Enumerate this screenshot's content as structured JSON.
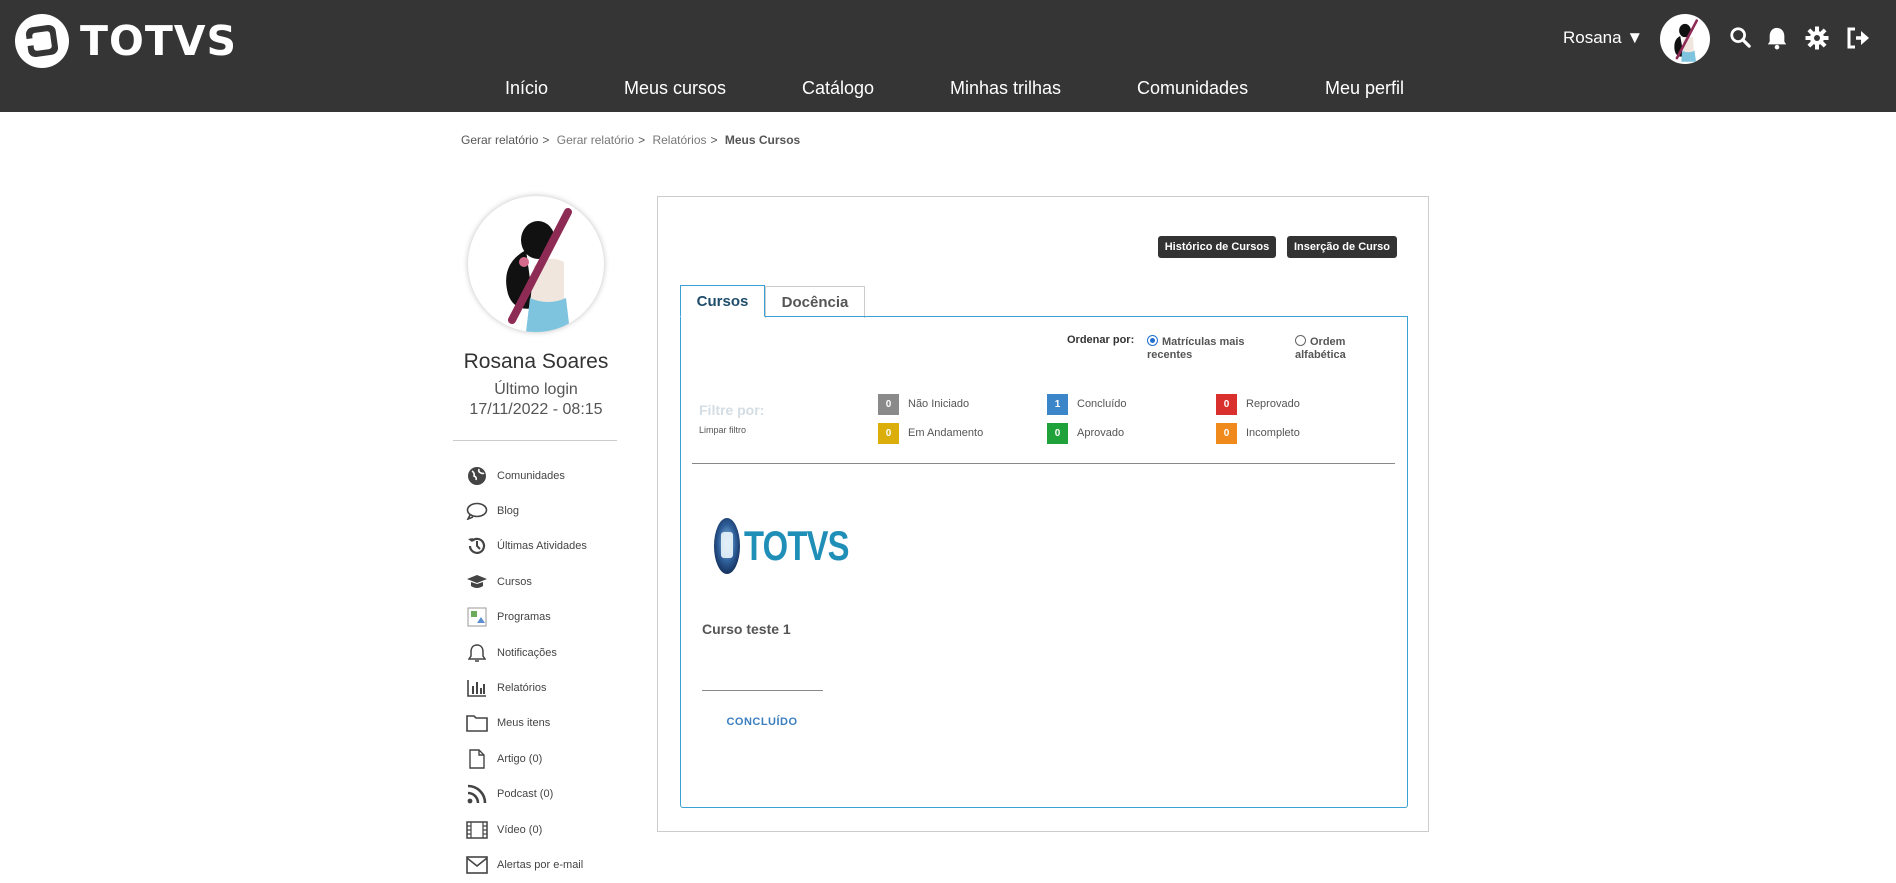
{
  "header": {
    "brand": "TOTVS",
    "nav": [
      "Início",
      "Meus cursos",
      "Catálogo",
      "Minhas trilhas",
      "Comunidades",
      "Meu perfil"
    ],
    "user_label": "Rosana ▼"
  },
  "breadcrumb": [
    "Gerar relatório",
    "Gerar relatório",
    "Relatórios",
    "Meus Cursos"
  ],
  "profile": {
    "name": "Rosana Soares",
    "last_login_label": "Último login",
    "last_login_value": "17/11/2022 - 08:15"
  },
  "menu": [
    {
      "label": "Comunidades",
      "icon": "globe-icon"
    },
    {
      "label": "Blog",
      "icon": "speech-bubble-icon"
    },
    {
      "label": "Últimas Atividades",
      "icon": "history-icon"
    },
    {
      "label": "Cursos",
      "icon": "graduation-cap-icon"
    },
    {
      "label": "Programas",
      "icon": "broken-image-icon"
    },
    {
      "label": "Notificações",
      "icon": "bell-icon"
    },
    {
      "label": "Relatórios",
      "icon": "bar-chart-icon"
    },
    {
      "label": "Meus itens",
      "icon": "folder-icon"
    },
    {
      "label": "Artigo (0)",
      "icon": "document-icon"
    },
    {
      "label": "Podcast (0)",
      "icon": "rss-icon"
    },
    {
      "label": "Vídeo (0)",
      "icon": "film-icon"
    },
    {
      "label": "Alertas por e-mail",
      "icon": "envelope-icon"
    }
  ],
  "buttons": {
    "history": "Histórico de Cursos",
    "insert": "Inserção de Curso"
  },
  "tabs": [
    "Cursos",
    "Docência"
  ],
  "order": {
    "label": "Ordenar por:",
    "options": [
      "Matrículas mais recentes",
      "Ordem alfabética"
    ],
    "selected": "Matrículas mais recentes"
  },
  "filter": {
    "title": "Filtre por:",
    "clear": "Limpar filtro",
    "items": [
      {
        "count": "0",
        "label": "Não Iniciado",
        "color": "#8a8a8a"
      },
      {
        "count": "1",
        "label": "Concluído",
        "color": "#3b86c8"
      },
      {
        "count": "0",
        "label": "Reprovado",
        "color": "#d9302e"
      },
      {
        "count": "0",
        "label": "Em Andamento",
        "color": "#dcae0c"
      },
      {
        "count": "0",
        "label": "Aprovado",
        "color": "#20a23a"
      },
      {
        "count": "0",
        "label": "Incompleto",
        "color": "#f08a1c"
      }
    ]
  },
  "course": {
    "logo_text": "TOTVS",
    "title": "Curso teste 1",
    "status": "CONCLUÍDO"
  },
  "colors": {
    "topbar": "#353535",
    "accent": "#3ba0d6",
    "status_link": "#3b7fc0"
  }
}
